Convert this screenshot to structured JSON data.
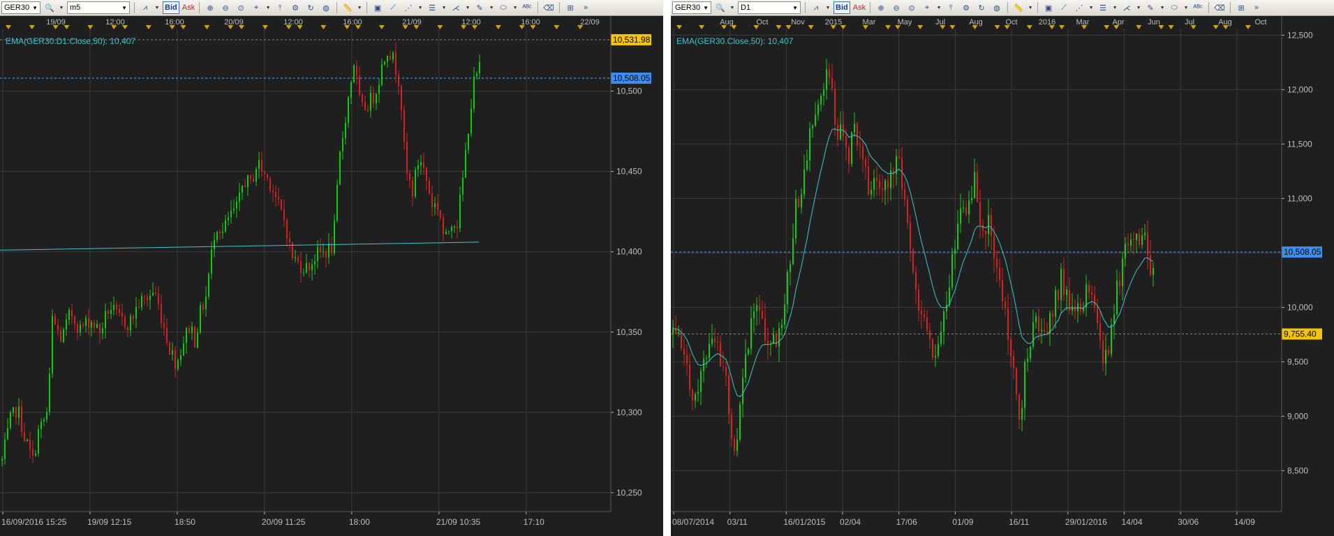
{
  "panels": [
    {
      "symbol": "GER30",
      "timeframe": "m5",
      "price_type_bid": "Bid",
      "price_type_ask": "Ask",
      "indicator_label": "EMA(GER30.D1.Close,50): 10,407",
      "price_tags": {
        "level_1": "10,531.98",
        "level_2": "10,508.05"
      }
    },
    {
      "symbol": "GER30",
      "timeframe": "D1",
      "price_type_bid": "Bid",
      "price_type_ask": "Ask",
      "indicator_label": "EMA(GER30.Close,50): 10,407",
      "price_tags": {
        "level_1": "10,508.05",
        "level_2": "9,755.40"
      }
    }
  ],
  "colors": {
    "background": "#1f1f1f",
    "axis_panel": "#2a2a2a",
    "grid": "#3b3b3b",
    "up_candle": "#14c814",
    "down_candle": "#d2231e",
    "ema_line": "#3cc6cc",
    "current_price_line": "#4aa8ff",
    "level_line": "#8a8a8a",
    "tag_yellow": "#f6c400",
    "tag_blue": "#3c8ff0",
    "axis_text": "#bdbdbd",
    "event_marker": "#d4a017"
  },
  "icons": [
    "search-icon",
    "chart-type-icon",
    "zoom-in-icon",
    "zoom-out-icon",
    "zoom-fit-icon",
    "crosshair-icon",
    "indicator-icon",
    "template-icon",
    "globe-icon",
    "ruler-icon",
    "image-icon",
    "trendline-icon",
    "hline-icon",
    "fibonacci-icon",
    "pen-icon",
    "ellipse-icon",
    "text-icon",
    "eraser-icon",
    "tree-icon",
    "more-icon"
  ],
  "chart_data": [
    {
      "type": "candlestick",
      "title": "GER30 m5",
      "ylim": [
        10240,
        10545
      ],
      "y_ticks": [
        "10,250",
        "10,300",
        "10,350",
        "10,400",
        "10,450",
        "10,500"
      ],
      "x_top_ticks": [
        "19/09",
        "12:00",
        "16:00",
        "20/09",
        "12:00",
        "16:00",
        "21/09",
        "12:00",
        "16:00",
        "22/09"
      ],
      "x_bottom_ticks": [
        "16/09/2016 15:25",
        "19/09 12:15",
        "18:50",
        "20/09 11:25",
        "18:00",
        "21/09 10:35",
        "17:10"
      ],
      "ema": {
        "name": "EMA(GER30.D1.Close,50)",
        "from": 10401,
        "to": 10406
      },
      "current_price": 10508.05,
      "level_line": 10531.98,
      "price_path": [
        [
          0,
          10270
        ],
        [
          12,
          10295
        ],
        [
          22,
          10303
        ],
        [
          32,
          10285
        ],
        [
          44,
          10270
        ],
        [
          52,
          10288
        ],
        [
          60,
          10295
        ],
        [
          66,
          10302
        ],
        [
          72,
          10358
        ],
        [
          85,
          10345
        ],
        [
          98,
          10362
        ],
        [
          112,
          10352
        ],
        [
          126,
          10358
        ],
        [
          140,
          10350
        ],
        [
          154,
          10366
        ],
        [
          168,
          10358
        ],
        [
          182,
          10355
        ],
        [
          196,
          10368
        ],
        [
          210,
          10372
        ],
        [
          218,
          10376
        ],
        [
          228,
          10360
        ],
        [
          240,
          10340
        ],
        [
          250,
          10330
        ],
        [
          260,
          10345
        ],
        [
          270,
          10355
        ],
        [
          276,
          10345
        ],
        [
          284,
          10362
        ],
        [
          292,
          10372
        ],
        [
          298,
          10392
        ],
        [
          306,
          10418
        ],
        [
          316,
          10412
        ],
        [
          326,
          10422
        ],
        [
          338,
          10428
        ],
        [
          346,
          10445
        ],
        [
          356,
          10442
        ],
        [
          366,
          10456
        ],
        [
          376,
          10448
        ],
        [
          386,
          10442
        ],
        [
          396,
          10428
        ],
        [
          406,
          10418
        ],
        [
          414,
          10398
        ],
        [
          426,
          10392
        ],
        [
          438,
          10390
        ],
        [
          450,
          10398
        ],
        [
          462,
          10400
        ],
        [
          474,
          10403
        ],
        [
          484,
          10460
        ],
        [
          494,
          10490
        ],
        [
          504,
          10518
        ],
        [
          514,
          10488
        ],
        [
          524,
          10492
        ],
        [
          534,
          10498
        ],
        [
          544,
          10515
        ],
        [
          552,
          10527
        ],
        [
          560,
          10520
        ],
        [
          570,
          10505
        ],
        [
          578,
          10450
        ],
        [
          588,
          10438
        ],
        [
          598,
          10460
        ],
        [
          606,
          10448
        ],
        [
          616,
          10430
        ],
        [
          626,
          10428
        ],
        [
          634,
          10405
        ],
        [
          644,
          10420
        ],
        [
          652,
          10418
        ],
        [
          660,
          10445
        ],
        [
          668,
          10478
        ],
        [
          676,
          10505
        ],
        [
          684,
          10514
        ]
      ]
    },
    {
      "type": "candlestick",
      "title": "GER30 D1",
      "ylim": [
        8150,
        12650
      ],
      "y_ticks": [
        "8,500",
        "9,000",
        "9,500",
        "10,000",
        "10,500",
        "11,000",
        "11,500",
        "12,000",
        "12,500"
      ],
      "x_top_ticks": [
        "Aug",
        "Oct",
        "Nov",
        "2015",
        "Mar",
        "May",
        "Jul",
        "Aug",
        "Oct",
        "2016",
        "Mar",
        "Apr",
        "Jun",
        "Jul",
        "Aug",
        "Oct"
      ],
      "x_bottom_ticks": [
        "08/07/2014",
        "03/11",
        "16/01/2015",
        "02/04",
        "17/06",
        "01/09",
        "16/11",
        "29/01/2016",
        "14/04",
        "30/06",
        "14/09"
      ],
      "ema": {
        "name": "EMA(GER30.Close,50)"
      },
      "current_price": 10508.05,
      "level_line": 9755.4,
      "price_path": [
        [
          0,
          9750
        ],
        [
          10,
          9650
        ],
        [
          20,
          9450
        ],
        [
          30,
          9150
        ],
        [
          40,
          9350
        ],
        [
          50,
          9600
        ],
        [
          60,
          9650
        ],
        [
          70,
          9500
        ],
        [
          78,
          9200
        ],
        [
          86,
          8750
        ],
        [
          94,
          8900
        ],
        [
          102,
          9500
        ],
        [
          110,
          9800
        ],
        [
          118,
          10000
        ],
        [
          126,
          9900
        ],
        [
          136,
          9700
        ],
        [
          146,
          9700
        ],
        [
          156,
          9850
        ],
        [
          166,
          10400
        ],
        [
          176,
          10900
        ],
        [
          186,
          11200
        ],
        [
          196,
          11550
        ],
        [
          206,
          11900
        ],
        [
          216,
          12050
        ],
        [
          226,
          12200
        ],
        [
          232,
          11700
        ],
        [
          242,
          11550
        ],
        [
          252,
          11400
        ],
        [
          262,
          11650
        ],
        [
          272,
          11350
        ],
        [
          282,
          11000
        ],
        [
          292,
          11150
        ],
        [
          302,
          11050
        ],
        [
          312,
          11200
        ],
        [
          322,
          11350
        ],
        [
          332,
          11000
        ],
        [
          342,
          10350
        ],
        [
          352,
          10000
        ],
        [
          362,
          9850
        ],
        [
          372,
          9600
        ],
        [
          382,
          9650
        ],
        [
          392,
          10000
        ],
        [
          402,
          10600
        ],
        [
          412,
          10800
        ],
        [
          422,
          10900
        ],
        [
          432,
          11250
        ],
        [
          442,
          10700
        ],
        [
          452,
          10750
        ],
        [
          462,
          10500
        ],
        [
          472,
          10100
        ],
        [
          482,
          9650
        ],
        [
          490,
          9300
        ],
        [
          498,
          9000
        ],
        [
          506,
          9600
        ],
        [
          516,
          9800
        ],
        [
          526,
          9900
        ],
        [
          536,
          9750
        ],
        [
          546,
          10050
        ],
        [
          556,
          10250
        ],
        [
          566,
          10100
        ],
        [
          576,
          9950
        ],
        [
          586,
          10000
        ],
        [
          596,
          10200
        ],
        [
          606,
          9900
        ],
        [
          616,
          9450
        ],
        [
          626,
          9700
        ],
        [
          636,
          10150
        ],
        [
          646,
          10500
        ],
        [
          656,
          10700
        ],
        [
          666,
          10550
        ],
        [
          676,
          10650
        ],
        [
          684,
          10400
        ],
        [
          690,
          10470
        ]
      ]
    }
  ]
}
